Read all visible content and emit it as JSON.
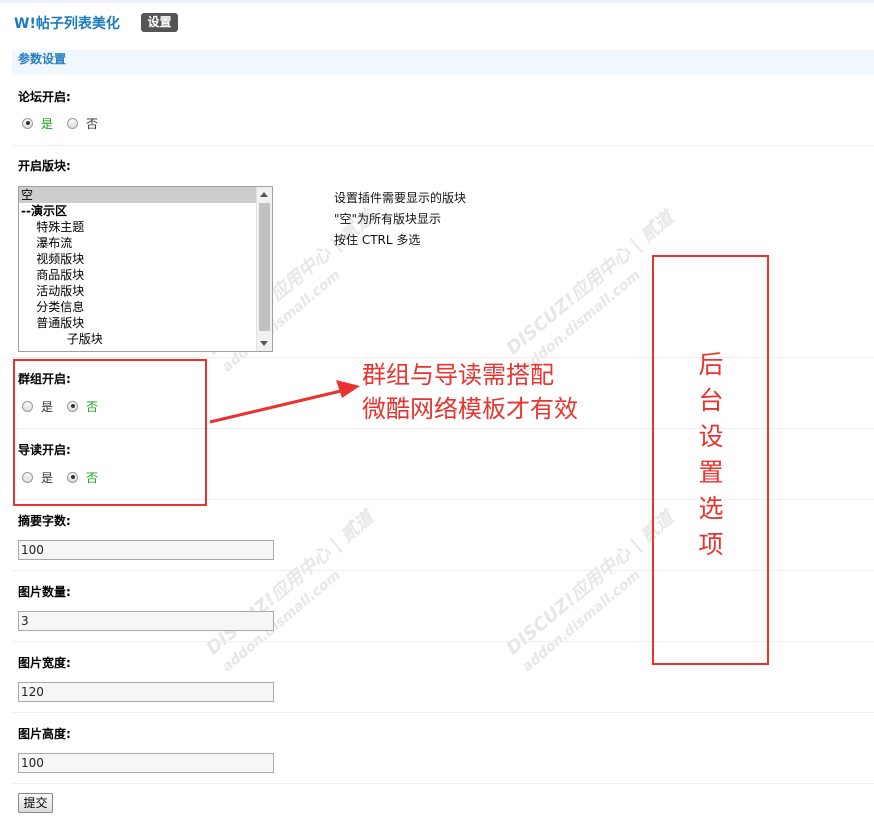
{
  "app": {
    "title": "W!帖子列表美化",
    "tab_label": "设置"
  },
  "section": {
    "title": "参数设置"
  },
  "forum": {
    "label": "论坛开启:",
    "options": [
      "是",
      "否"
    ],
    "selected": "是"
  },
  "blocks": {
    "label": "开启版块:",
    "items": [
      "空",
      "--演示区",
      "    特殊主题",
      "    瀑布流",
      "    视频版块",
      "    商品版块",
      "    活动版块",
      "    分类信息",
      "    普通版块",
      "            子版块"
    ],
    "selected_index": 0,
    "hint_lines": [
      "设置插件需要显示的版块",
      "\"空\"为所有版块显示",
      "按住 CTRL 多选"
    ]
  },
  "group": {
    "label": "群组开启:",
    "options": [
      "是",
      "否"
    ],
    "selected": "否"
  },
  "guide": {
    "label": "导读开启:",
    "options": [
      "是",
      "否"
    ],
    "selected": "否"
  },
  "summary": {
    "label": "摘要字数:",
    "value": "100"
  },
  "image_count": {
    "label": "图片数量:",
    "value": "3"
  },
  "image_width": {
    "label": "图片宽度:",
    "value": "120"
  },
  "image_height": {
    "label": "图片高度:",
    "value": "100"
  },
  "submit_label": "提交",
  "annotations": {
    "group_note_line1": "群组与导读需搭配",
    "group_note_line2": "微酷网络模板才有效",
    "vertical_note": [
      "后",
      "台",
      "设",
      "置",
      "选",
      "项"
    ]
  },
  "watermark": {
    "text": "DISCUZ!应用中心 | 贰道",
    "subtext": "addon.dismall.com"
  },
  "colors": {
    "accent": "#1b7bbd",
    "annotation": "#e8332f",
    "selected_option": "#1aa21a",
    "section_bg": "#f0f7fd"
  }
}
